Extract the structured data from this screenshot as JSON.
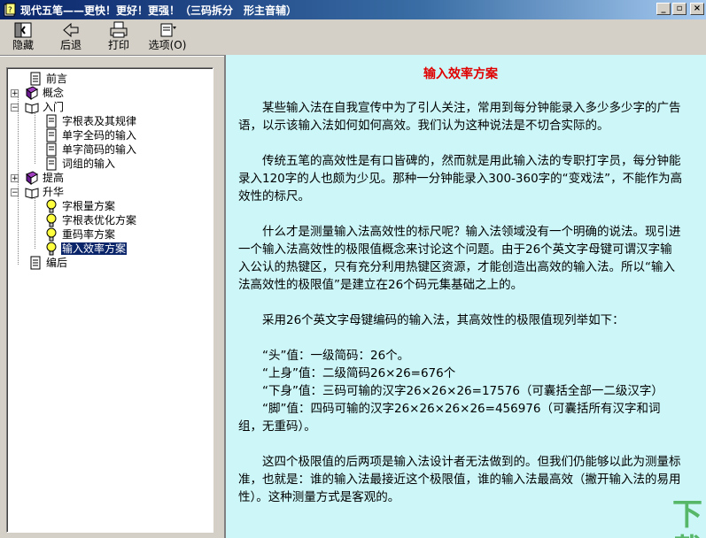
{
  "window": {
    "title": "现代五笔——更快！更好！更强！（三码拆分　形主音辅）",
    "minimize": "_",
    "restore": "▫",
    "close": "×"
  },
  "toolbar": {
    "hide": "隐藏",
    "back": "后退",
    "print": "打印",
    "options": "选项(O)"
  },
  "tree": {
    "preface": "前言",
    "concept": "概念",
    "intro": "入门",
    "intro_items": [
      "字根表及其规律",
      "单字全码的输入",
      "单字简码的输入",
      "词组的输入"
    ],
    "improve": "提高",
    "advance": "升华",
    "advance_items": [
      "字根量方案",
      "字根表优化方案",
      "重码率方案",
      "输入效率方案"
    ],
    "afterword": "编后"
  },
  "content": {
    "heading": "输入效率方案",
    "p1": "某些输入法在自我宣传中为了引人关注，常用到每分钟能录入多少多少字的广告语，以示该输入法如何如何高效。我们认为这种说法是不切合实际的。",
    "p2": "传统五笔的高效性是有口皆碑的，然而就是用此输入法的专职打字员，每分钟能录入120字的人也颇为少见。那种一分钟能录入300-360字的“变戏法”，不能作为高效性的标尺。",
    "p3": "什么才是测量输入法高效性的标尺呢？输入法领域没有一个明确的说法。现引进一个输入法高效性的极限值概念来讨论这个问题。由于26个英文字母键可谓汉字输入公认的热键区，只有充分利用热键区资源，才能创造出高效的输入法。所以“输入法高效性的极限值”是建立在26个码元集基础之上的。",
    "p4": "采用26个英文字母键编码的输入法，其高效性的极限值现列举如下：",
    "v1": "“头”值：一级简码：26个。",
    "v2": "“上身”值：二级简码26×26=676个",
    "v3": "“下身”值：三码可输的汉字26×26×26=17576（可囊括全部一二级汉字）",
    "v4": "“脚”值：四码可输的汉字26×26×26×26=456976（可囊括所有汉字和词组，无重码）。",
    "p5": "这四个极限值的后两项是输入法设计者无法做到的。但我们仍能够以此为测量标准，也就是：谁的输入法最接近这个极限值，谁的输入法最高效（撇开输入法的易用性）。这种测量方式是客观的。"
  },
  "watermark": "下载吧"
}
